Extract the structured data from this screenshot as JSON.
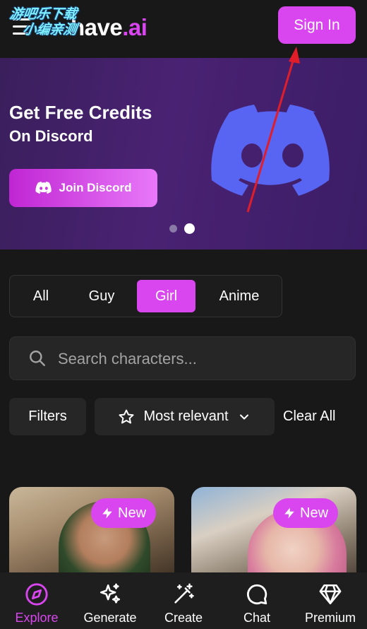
{
  "header": {
    "logo_text": "have",
    "logo_accent": ".ai",
    "watermark_line1": "游吧乐下载",
    "watermark_line2": "小编亲测",
    "signin_label": "Sign In"
  },
  "banner": {
    "title": "Get Free Credits",
    "subtitle": "On Discord",
    "button_label": "Join Discord",
    "slides": 2,
    "active_slide": 2
  },
  "tabs": [
    {
      "label": "All",
      "active": false
    },
    {
      "label": "Guy",
      "active": false
    },
    {
      "label": "Girl",
      "active": true
    },
    {
      "label": "Anime",
      "active": false
    }
  ],
  "search": {
    "placeholder": "Search characters..."
  },
  "filters": {
    "filters_label": "Filters",
    "sort_label": "Most relevant",
    "clear_label": "Clear All"
  },
  "cards": [
    {
      "badge": "New"
    },
    {
      "badge": "New"
    }
  ],
  "nav": [
    {
      "label": "Explore",
      "icon": "compass-icon",
      "active": true
    },
    {
      "label": "Generate",
      "icon": "sparkles-icon",
      "active": false
    },
    {
      "label": "Create",
      "icon": "magic-wand-icon",
      "active": false
    },
    {
      "label": "Chat",
      "icon": "chat-bubble-icon",
      "active": false
    },
    {
      "label": "Premium",
      "icon": "diamond-icon",
      "active": false
    }
  ],
  "colors": {
    "accent": "#d946ef",
    "background": "#181818",
    "discord_blurple": "#5865f2",
    "annotation_arrow": "#e11d2a"
  }
}
